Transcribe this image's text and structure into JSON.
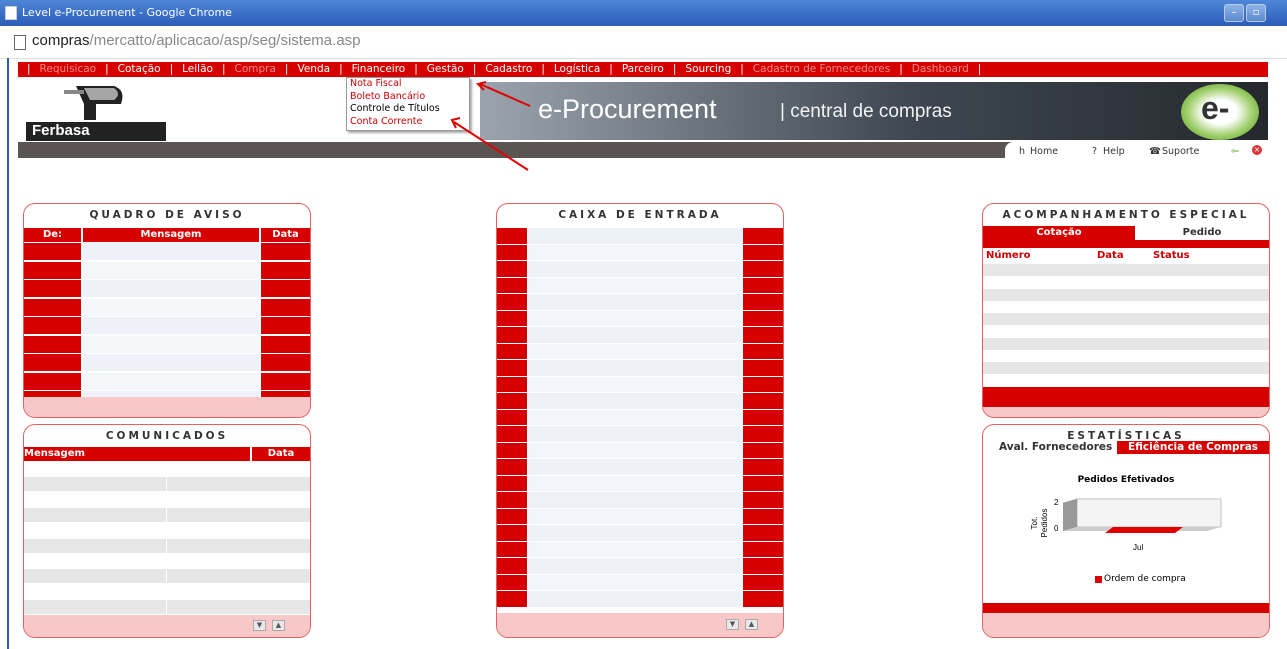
{
  "window": {
    "title": "Level e-Procurement - Google Chrome",
    "url_host": "compras",
    "url_path": "/mercatto/aplicacao/asp/seg/sistema.asp"
  },
  "nav": [
    {
      "label": "Requisicao",
      "dim": true
    },
    {
      "label": "Cotação",
      "dim": false
    },
    {
      "label": "Leilão",
      "dim": false
    },
    {
      "label": "Compra",
      "dim": true
    },
    {
      "label": "Venda",
      "dim": false
    },
    {
      "label": "Financeiro",
      "dim": false
    },
    {
      "label": "Gestão",
      "dim": false
    },
    {
      "label": "Cadastro",
      "dim": false
    },
    {
      "label": "Logística",
      "dim": false
    },
    {
      "label": "Parceiro",
      "dim": false
    },
    {
      "label": "Sourcing",
      "dim": false
    },
    {
      "label": "Cadastro de Fornecedores",
      "dim": true
    },
    {
      "label": "Dashboard",
      "dim": true
    }
  ],
  "dropdown": [
    "Nota Fiscal",
    "Boleto Bancário",
    "Controle de Títulos",
    "Conta Corrente"
  ],
  "header": {
    "logo_text": "Ferbasa",
    "banner_title": "e-Procurement",
    "banner_subtitle": "| central de compras",
    "e_logo": "e-"
  },
  "toolbar": {
    "home": "Home",
    "help": "Help",
    "support": "Suporte"
  },
  "quadro": {
    "title": "QUADRO DE AVISO",
    "col_from": "De:",
    "col_msg": "Mensagem",
    "col_date": "Data"
  },
  "comunicados": {
    "title": "COMUNICADOS",
    "col_msg": "Mensagem",
    "col_date": "Data"
  },
  "caixa": {
    "title": "CAIXA DE ENTRADA"
  },
  "acompanhamento": {
    "title": "ACOMPANHAMENTO ESPECIAL",
    "tab_active": "Cotação",
    "tab_other": "Pedido",
    "col_num": "Número",
    "col_date": "Data",
    "col_status": "Status"
  },
  "estatisticas": {
    "title": "ESTATÍSTICAS",
    "tab_active": "Aval. Fornecedores",
    "tab_other": "Eficiência de Compras",
    "chart_title": "Pedidos Efetivados",
    "ylabel": "Tot. Pedidos",
    "tick_top": "2",
    "tick_bottom": "0",
    "xcat": "Jul",
    "legend": "Ordem de compra",
    "legend_color": "#e00000"
  },
  "chart_data": {
    "type": "bar",
    "title": "Pedidos Efetivados",
    "categories": [
      "Jul"
    ],
    "series": [
      {
        "name": "Ordem de compra",
        "values": [
          0
        ]
      }
    ],
    "ylabel": "Tot. Pedidos",
    "ylim": [
      0,
      2
    ]
  }
}
